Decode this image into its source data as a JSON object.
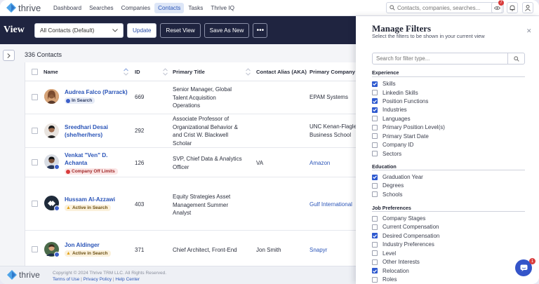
{
  "app": {
    "brand": "thrive"
  },
  "nav": {
    "items": [
      "Dashboard",
      "Searches",
      "Companies",
      "Contacts",
      "Tasks",
      "Thrive IQ"
    ],
    "active": "Contacts",
    "search_placeholder": "Contacts, companies, searches...",
    "notification_count": "7"
  },
  "toolbar": {
    "title": "View",
    "view_select": "All Contacts (Default)",
    "update_label": "Update",
    "reset_label": "Reset View",
    "save_label": "Save As New",
    "more_label": "•••"
  },
  "list": {
    "count_label": "336 Contacts",
    "columns": {
      "name": "Name",
      "id": "ID",
      "title": "Primary Title",
      "alias": "Contact Alias (AKA)",
      "company": "Primary Company"
    },
    "rows": [
      {
        "name": "Audrea Falco (Parrack)",
        "badge": "In Search",
        "id": "669",
        "title": "Senior Manager, Global Talent Acquisition Operations",
        "alias": "",
        "company": "EPAM Systems"
      },
      {
        "name": "Sreedhari Desai (she/her/hers)",
        "badge": "",
        "id": "292",
        "title": "Associate Professor of Organizational Behavior & and Crist W. Blackwell Scholar",
        "alias": "",
        "company": "UNC Kenan-Flagle Business School"
      },
      {
        "name": "Venkat \"Ven\" D. Achanta",
        "badge": "Company Off Limits",
        "id": "126",
        "title": "SVP, Chief Data & Analytics Officer",
        "alias": "VA",
        "company": "Amazon"
      },
      {
        "name": "Hussam Al-Azzawi",
        "badge": "Active in Search",
        "id": "403",
        "title": "Equity Strategies Asset Management Summer Analyst",
        "alias": "",
        "company": "Gulf International"
      },
      {
        "name": "Jon Aldinger",
        "badge": "Active in Search",
        "id": "371",
        "title": "Chief Architect, Front-End",
        "alias": "Jon Smith",
        "company": "Snapyr"
      }
    ]
  },
  "footer": {
    "brand": "thrive",
    "copyright": "Copyright © 2024 Thrive TRM LLC. All Rights Reserved.",
    "terms": "Terms of Use",
    "privacy": "Privacy Policy",
    "help": "Help Center"
  },
  "panel": {
    "title": "Manage Filters",
    "subtitle": "Select the filters to be shown in your current view",
    "search_placeholder": "Search for filter type...",
    "sections": [
      {
        "title": "Experience",
        "options": [
          {
            "label": "Skills",
            "checked": true
          },
          {
            "label": "Linkedin Skills",
            "checked": false
          },
          {
            "label": "Position Functions",
            "checked": true
          },
          {
            "label": "Industries",
            "checked": true
          },
          {
            "label": "Languages",
            "checked": false
          },
          {
            "label": "Primary Position Level(s)",
            "checked": false
          },
          {
            "label": "Primary Start Date",
            "checked": false
          },
          {
            "label": "Company ID",
            "checked": false
          },
          {
            "label": "Sectors",
            "checked": false
          }
        ]
      },
      {
        "title": "Education",
        "options": [
          {
            "label": "Graduation Year",
            "checked": true
          },
          {
            "label": "Degrees",
            "checked": false
          },
          {
            "label": "Schools",
            "checked": false
          }
        ]
      },
      {
        "title": "Job Preferences",
        "options": [
          {
            "label": "Company Stages",
            "checked": false
          },
          {
            "label": "Current Compensation",
            "checked": false
          },
          {
            "label": "Desired Compensation",
            "checked": true
          },
          {
            "label": "Industry Preferences",
            "checked": false
          },
          {
            "label": "Level",
            "checked": false
          },
          {
            "label": "Other Interests",
            "checked": false
          },
          {
            "label": "Relocation",
            "checked": true
          },
          {
            "label": "Roles",
            "checked": false
          }
        ]
      }
    ]
  },
  "chat": {
    "badge": "1"
  },
  "colors": {
    "brand_blue": "#2f5ad0",
    "toolbar_bg": "#1f2440",
    "link": "#2b55b8",
    "alert_red": "#d93b3b"
  }
}
